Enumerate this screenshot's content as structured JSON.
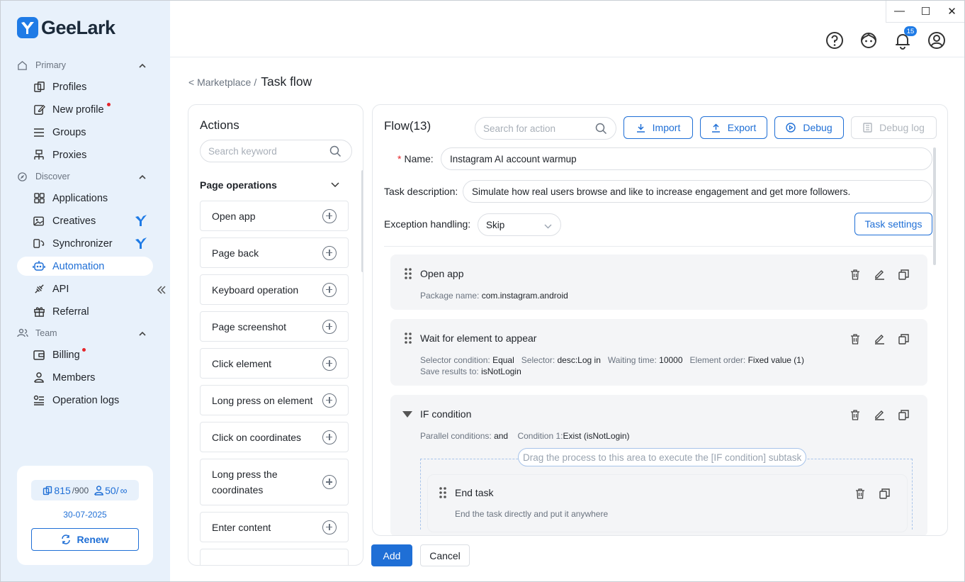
{
  "app": {
    "name": "GeeLark"
  },
  "sidebar": {
    "sections": [
      {
        "label": "Primary",
        "items": [
          {
            "label": "Profiles",
            "icon": "profiles-icon"
          },
          {
            "label": "New profile",
            "icon": "edit-icon",
            "dot": true
          },
          {
            "label": "Groups",
            "icon": "list-icon"
          },
          {
            "label": "Proxies",
            "icon": "network-icon"
          }
        ]
      },
      {
        "label": "Discover",
        "items": [
          {
            "label": "Applications",
            "icon": "grid-icon"
          },
          {
            "label": "Creatives",
            "icon": "image-icon",
            "tag": "geelark-icon"
          },
          {
            "label": "Synchronizer",
            "icon": "sync-icon",
            "tag": "geelark-icon"
          },
          {
            "label": "Automation",
            "icon": "robot-icon",
            "active": true
          },
          {
            "label": "API",
            "icon": "api-icon"
          },
          {
            "label": "Referral",
            "icon": "gift-icon"
          }
        ]
      },
      {
        "label": "Team",
        "items": [
          {
            "label": "Billing",
            "icon": "wallet-icon",
            "dot": true
          },
          {
            "label": "Members",
            "icon": "person-icon"
          },
          {
            "label": "Operation logs",
            "icon": "log-icon"
          }
        ]
      }
    ],
    "plan": {
      "profiles": "815",
      "profiles_total": "/900",
      "members": "50/",
      "members_total": "∞",
      "expiry": "30-07-2025",
      "renew_label": "Renew"
    }
  },
  "topbar": {
    "notification_count": "15"
  },
  "breadcrumb": {
    "parent": "< Marketplace",
    "separator": "/",
    "current": "Task flow"
  },
  "actions_panel": {
    "title": "Actions",
    "search_placeholder": "Search keyword",
    "group_title": "Page operations",
    "items": [
      "Open app",
      "Page back",
      "Keyboard operation",
      "Page screenshot",
      "Click element",
      "Long press on element",
      "Click on coordinates",
      "Long press the coordinates",
      "Enter content"
    ]
  },
  "flow": {
    "title": "Flow(13)",
    "search_placeholder": "Search for action",
    "buttons": {
      "import": "Import",
      "export": "Export",
      "debug": "Debug",
      "debug_log": "Debug log"
    },
    "name_label": "Name:",
    "name_value": "Instagram AI account warmup",
    "desc_label": "Task description:",
    "desc_value": "Simulate how real users browse and like to increase engagement and get more followers.",
    "exception_label": "Exception handling:",
    "exception_value": "Skip",
    "task_settings": "Task settings",
    "steps": {
      "open_app": {
        "title": "Open app",
        "k1": "Package name:",
        "v1": "com.instagram.android"
      },
      "wait": {
        "title": "Wait for element to appear",
        "k1": "Selector condition:",
        "v1": "Equal",
        "k2": "Selector:",
        "v2": "desc:Log in",
        "k3": "Waiting time:",
        "v3": "10000",
        "k4": "Element order:",
        "v4": "Fixed value (1)",
        "k5": "Save results to:",
        "v5": "isNotLogin"
      },
      "if": {
        "title": "IF condition",
        "k1": "Parallel conditions:",
        "v1": "and",
        "k2": "Condition 1:",
        "v2": "Exist (isNotLogin)",
        "drop_hint": "Drag the process to this area to execute the [IF condition] subtask"
      },
      "end": {
        "title": "End task",
        "sub": "End the task directly and put it anywhere"
      }
    }
  },
  "footer": {
    "add": "Add",
    "cancel": "Cancel"
  }
}
